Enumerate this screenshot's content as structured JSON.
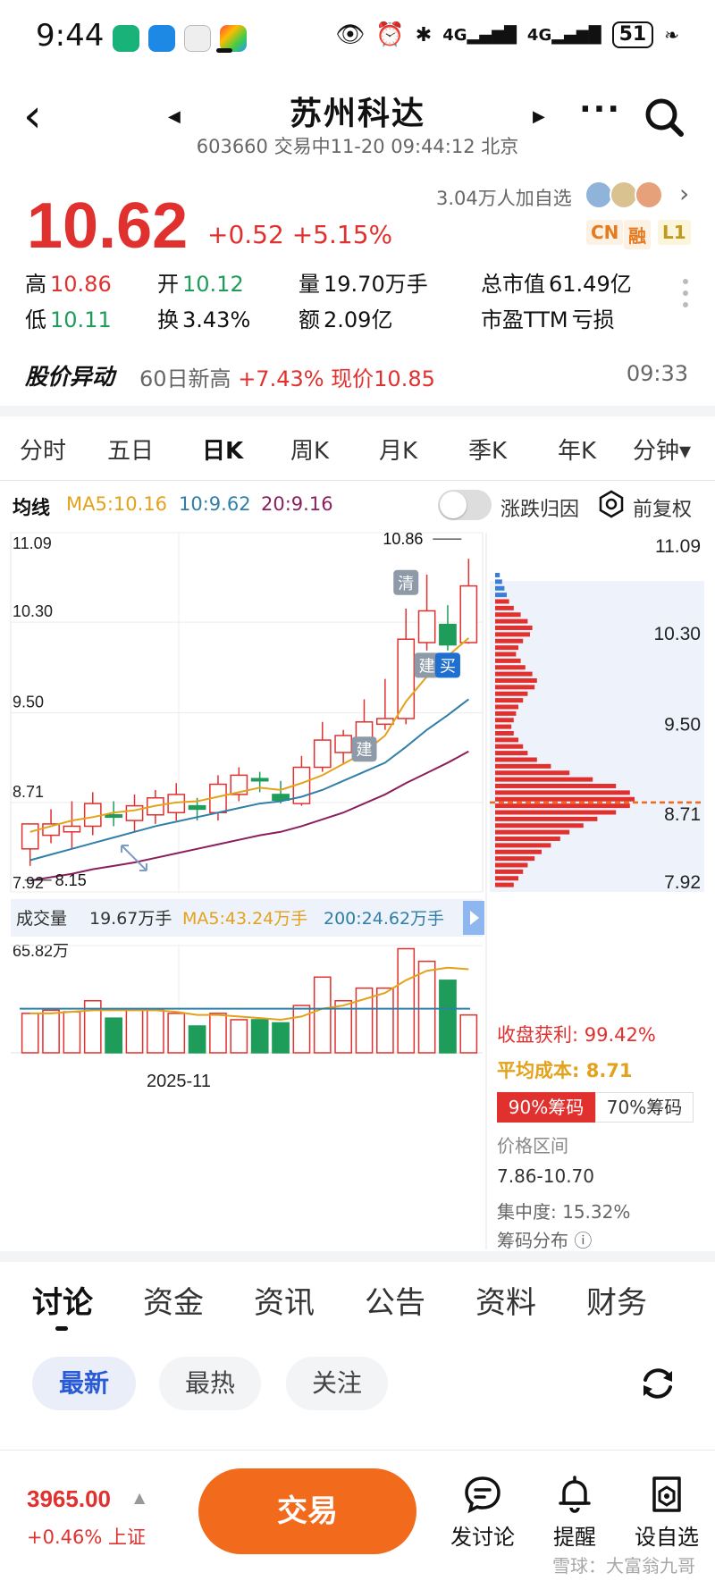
{
  "status_bar": {
    "time": "9:44",
    "network1": "4G",
    "network2": "4G",
    "battery": "51"
  },
  "header": {
    "title": "苏州科达",
    "subtitle": "603660 交易中11-20 09:44:12 北京",
    "icons": [
      "back-icon",
      "prev-stock-icon",
      "next-stock-icon",
      "more-icon",
      "search-icon"
    ]
  },
  "quote": {
    "price": "10.62",
    "change": "+0.52 +5.15%",
    "followers": "3.04万人加自选",
    "badges": [
      "CN",
      "融",
      "L1"
    ],
    "stats": {
      "high_label": "高",
      "high": "10.86",
      "low_label": "低",
      "low": "10.11",
      "open_label": "开",
      "open": "10.12",
      "turnover_label": "换",
      "turnover": "3.43%",
      "volume_label": "量",
      "volume": "19.70万手",
      "amount_label": "额",
      "amount": "2.09亿",
      "mktcap_label": "总市值",
      "mktcap": "61.49亿",
      "pe_label": "市盈TTM",
      "pe": "亏损"
    }
  },
  "alert": {
    "title": "股价异动",
    "text_prefix": "60日新高",
    "text_value": "+7.43% 现价10.85",
    "time": "09:33"
  },
  "period_tabs": [
    "分时",
    "五日",
    "日K",
    "周K",
    "月K",
    "季K",
    "年K",
    "分钟▾"
  ],
  "ma_row": {
    "label": "均线",
    "ma5": "MA5:10.16",
    "ma10": "10:9.62",
    "ma20": "20:9.16",
    "toggle_label": "涨跌归因",
    "fuquan_label": "前复权"
  },
  "chart_data": {
    "type": "candlestick",
    "y_ticks": [
      "11.09",
      "10.30",
      "9.50",
      "8.71",
      "7.92"
    ],
    "ylim": [
      7.92,
      11.09
    ],
    "high_marker": "10.86",
    "low_marker": "8.15",
    "x_label": "2025-11",
    "markers": [
      "清",
      "建",
      "买",
      "建"
    ],
    "candles": [
      {
        "o": 8.3,
        "h": 8.42,
        "l": 8.15,
        "c": 8.52
      },
      {
        "o": 8.42,
        "h": 8.65,
        "l": 8.35,
        "c": 8.52
      },
      {
        "o": 8.45,
        "h": 8.72,
        "l": 8.3,
        "c": 8.5
      },
      {
        "o": 8.5,
        "h": 8.8,
        "l": 8.42,
        "c": 8.7
      },
      {
        "o": 8.6,
        "h": 8.72,
        "l": 8.5,
        "c": 8.58
      },
      {
        "o": 8.55,
        "h": 8.78,
        "l": 8.45,
        "c": 8.68
      },
      {
        "o": 8.6,
        "h": 8.82,
        "l": 8.52,
        "c": 8.75
      },
      {
        "o": 8.62,
        "h": 8.88,
        "l": 8.55,
        "c": 8.78
      },
      {
        "o": 8.68,
        "h": 8.75,
        "l": 8.55,
        "c": 8.65
      },
      {
        "o": 8.62,
        "h": 8.95,
        "l": 8.55,
        "c": 8.87
      },
      {
        "o": 8.78,
        "h": 9.02,
        "l": 8.72,
        "c": 8.95
      },
      {
        "o": 8.92,
        "h": 8.98,
        "l": 8.8,
        "c": 8.9
      },
      {
        "o": 8.78,
        "h": 8.9,
        "l": 8.7,
        "c": 8.73
      },
      {
        "o": 8.7,
        "h": 9.12,
        "l": 8.68,
        "c": 9.02
      },
      {
        "o": 9.02,
        "h": 9.42,
        "l": 8.98,
        "c": 9.26
      },
      {
        "o": 9.15,
        "h": 9.35,
        "l": 9.05,
        "c": 9.3
      },
      {
        "o": 9.28,
        "h": 9.62,
        "l": 9.2,
        "c": 9.42
      },
      {
        "o": 9.4,
        "h": 9.8,
        "l": 9.35,
        "c": 9.45
      },
      {
        "o": 9.45,
        "h": 10.42,
        "l": 9.4,
        "c": 10.15
      },
      {
        "o": 10.12,
        "h": 10.72,
        "l": 10.05,
        "c": 10.4
      },
      {
        "o": 10.28,
        "h": 10.45,
        "l": 10.05,
        "c": 10.1
      },
      {
        "o": 10.12,
        "h": 10.86,
        "l": 10.11,
        "c": 10.62
      }
    ],
    "ma5": [
      8.45,
      8.5,
      8.55,
      8.58,
      8.62,
      8.64,
      8.68,
      8.71,
      8.72,
      8.76,
      8.8,
      8.84,
      8.82,
      8.88,
      8.95,
      9.05,
      9.15,
      9.3,
      9.6,
      9.82,
      10.0,
      10.16
    ],
    "ma10": [
      8.2,
      8.25,
      8.3,
      8.35,
      8.4,
      8.45,
      8.5,
      8.54,
      8.58,
      8.62,
      8.66,
      8.7,
      8.72,
      8.76,
      8.82,
      8.9,
      8.98,
      9.06,
      9.2,
      9.35,
      9.48,
      9.62
    ],
    "ma20": [
      8.02,
      8.05,
      8.08,
      8.12,
      8.15,
      8.18,
      8.22,
      8.26,
      8.3,
      8.34,
      8.38,
      8.42,
      8.45,
      8.5,
      8.56,
      8.62,
      8.7,
      8.78,
      8.88,
      8.97,
      9.06,
      9.16
    ],
    "volume_header": {
      "label": "成交量",
      "vol": "19.67万手",
      "ma5": "MA5:43.24万手",
      "ma200": "200:24.62万手",
      "max": "65.82万"
    },
    "volumes": [
      25,
      27,
      26,
      33,
      22,
      27,
      27,
      25,
      17,
      25,
      21,
      21,
      19,
      30,
      48,
      33,
      41,
      41,
      66,
      58,
      46,
      24
    ],
    "volume_ma5": [
      25,
      25,
      26,
      27,
      27,
      27,
      27,
      26,
      24,
      24,
      23,
      22,
      21,
      23,
      28,
      30,
      34,
      38,
      46,
      52,
      54,
      53
    ],
    "volume_ma200": 28
  },
  "chip_distribution": {
    "y_ticks": [
      "11.09",
      "10.30",
      "9.50",
      "8.71",
      "7.92"
    ],
    "profit_label": "收盘获利:",
    "profit": "99.42%",
    "avg_cost_label": "平均成本:",
    "avg_cost": "8.71",
    "tab_90": "90%筹码",
    "tab_70": "70%筹码",
    "range_label": "价格区间",
    "range": "7.86-10.70",
    "concentration": "集中度: 15.32%",
    "dist_label": "筹码分布",
    "bars": [
      2,
      3,
      4,
      5,
      6,
      8,
      11,
      14,
      16,
      15,
      12,
      10,
      9,
      11,
      13,
      16,
      18,
      17,
      14,
      12,
      10,
      9,
      8,
      7,
      8,
      10,
      12,
      14,
      18,
      24,
      32,
      42,
      52,
      58,
      60,
      58,
      52,
      44,
      38,
      32,
      28,
      24,
      20,
      17,
      14,
      12,
      10,
      8
    ]
  },
  "bottom_tabs": [
    "讨论",
    "资金",
    "资讯",
    "公告",
    "资料",
    "财务"
  ],
  "filter_chips": [
    "最新",
    "最热",
    "关注"
  ],
  "footer": {
    "index_value": "3965.00",
    "index_change": "+0.46% 上证",
    "trade": "交易",
    "actions": [
      "发讨论",
      "提醒",
      "设自选"
    ],
    "watermark": "雪球：大富翁九哥"
  },
  "colors": {
    "up": "#e0312f",
    "down": "#1e9c5a",
    "ma5": "#e3a21a",
    "ma10": "#2f7fa8",
    "ma20": "#8a1f5c",
    "accent": "#f26a1b"
  }
}
